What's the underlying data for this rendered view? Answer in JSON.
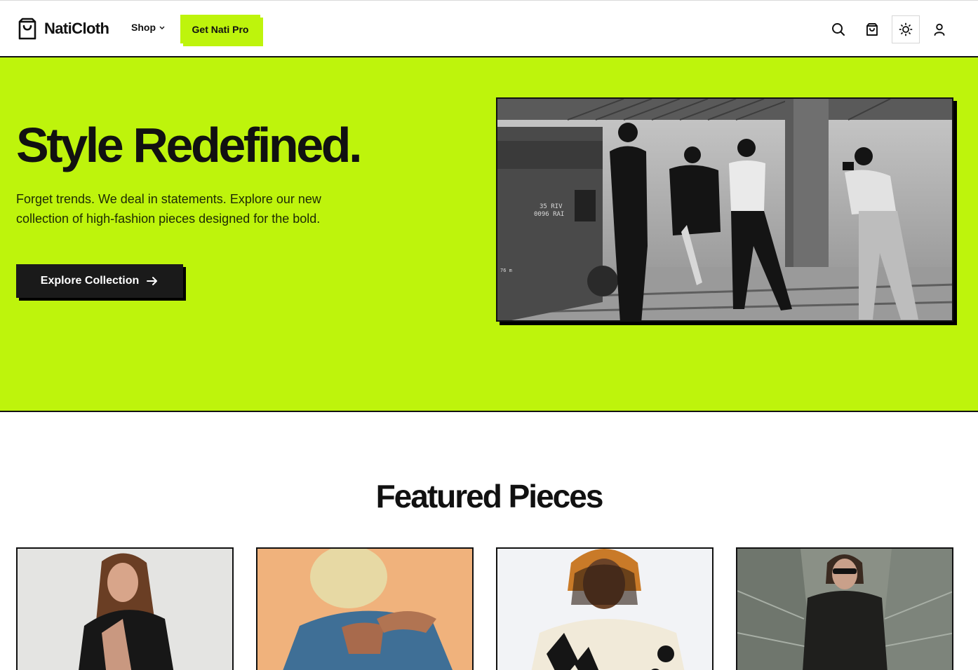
{
  "brand": {
    "name": "NatiCloth",
    "icon": "shopping-bag-icon"
  },
  "nav": {
    "shop_label": "Shop",
    "pro_label": "Get Nati Pro",
    "icons": [
      "search-icon",
      "cart-icon",
      "sun-icon",
      "user-icon"
    ]
  },
  "hero": {
    "title": "Style Redefined.",
    "text": "Forget trends. We deal in statements. Explore our new collection of high-fashion pieces designed for the bold.",
    "cta_label": "Explore Collection",
    "photo_text": [
      "35 RIV",
      "0096 RAI",
      "76 m"
    ]
  },
  "featured": {
    "title": "Featured Pieces"
  },
  "colors": {
    "accent": "#bef40c",
    "dark": "#111111",
    "button": "#1a1a1a"
  }
}
